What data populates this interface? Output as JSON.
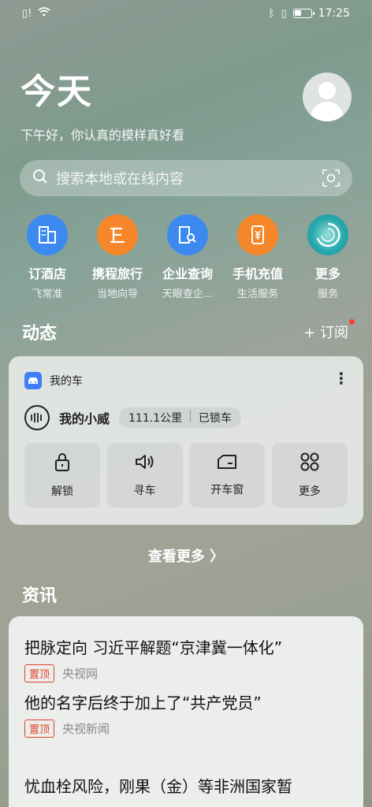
{
  "status_bar": {
    "time": "17:25"
  },
  "header": {
    "title": "今天",
    "greeting": "下午好，你认真的模样真好看"
  },
  "search": {
    "placeholder": "搜索本地或在线内容"
  },
  "services": [
    {
      "label": "订酒店",
      "sub": "飞常准",
      "color": "#3c8af0",
      "icon": "hotel-icon"
    },
    {
      "label": "携程旅行",
      "sub": "当地向导",
      "color": "#f5862a",
      "icon": "travel-icon"
    },
    {
      "label": "企业查询",
      "sub": "天眼查企...",
      "color": "#3c8af0",
      "icon": "company-search-icon"
    },
    {
      "label": "手机充值",
      "sub": "生活服务",
      "color": "#f5862a",
      "icon": "phone-recharge-icon"
    },
    {
      "label": "更多",
      "sub": "服务",
      "color": "#1fa0a6",
      "icon": "more-services-icon"
    }
  ],
  "dynamics": {
    "title": "动态",
    "subscribe": "+ 订阅"
  },
  "car_card": {
    "app_name": "我的车",
    "car_name": "我的小威",
    "mileage": "111.1公里",
    "lock_status": "已锁车",
    "actions": [
      {
        "label": "解锁",
        "icon": "lock-icon"
      },
      {
        "label": "寻车",
        "icon": "horn-icon"
      },
      {
        "label": "开车窗",
        "icon": "window-icon"
      },
      {
        "label": "更多",
        "icon": "grid-icon"
      }
    ]
  },
  "see_more": "查看更多 〉",
  "news": {
    "title": "资讯",
    "items": [
      {
        "headline": "把脉定向 习近平解题“京津冀一体化”",
        "tag": "置顶",
        "source": "央视网"
      },
      {
        "headline": "他的名字后终于加上了“共产党员”",
        "tag": "置顶",
        "source": "央视新闻"
      },
      {
        "headline": "忧血栓风险，刚果（金）等非洲国家暂",
        "tag": "",
        "source": ""
      }
    ]
  }
}
